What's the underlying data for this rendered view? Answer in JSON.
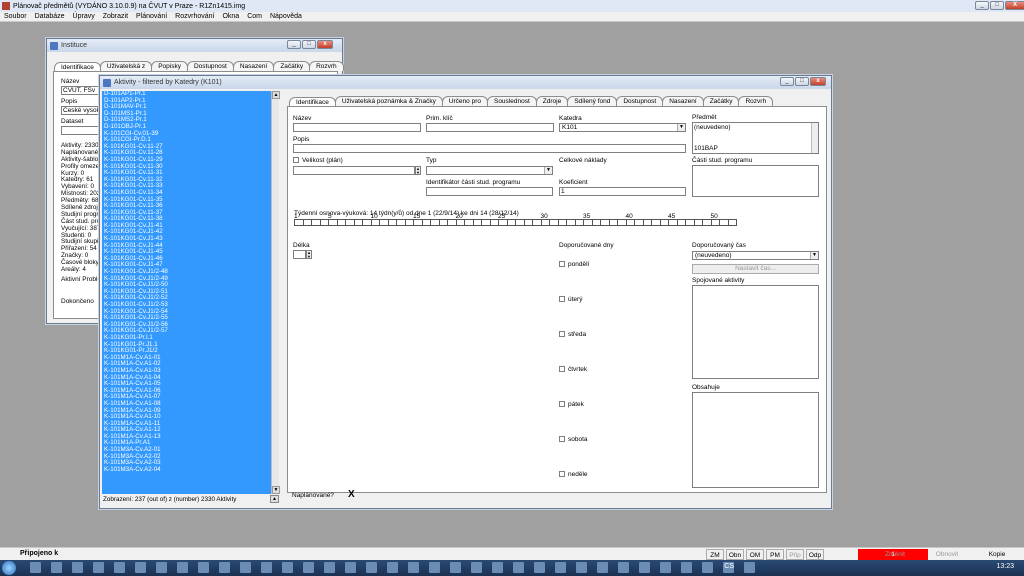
{
  "app": {
    "title": "Plánovač předmětů (VYDÁNO 3.10.0.9) na ČVUT v Praze - R1Zn1415.img",
    "min": "_",
    "max": "□",
    "close": "X"
  },
  "menu": [
    "Soubor",
    "Databáze",
    "Úpravy",
    "Zobrazit",
    "Plánování",
    "Rozvrhování",
    "Okna",
    "Com",
    "Nápověda"
  ],
  "instituce": {
    "title": "Instituce",
    "tabs": [
      "Identifikace",
      "Uživatelská z",
      "Popisky",
      "Dostupnost",
      "Nasazení",
      "Začátky",
      "Rozvrh"
    ],
    "nazev_label": "Název",
    "nazev_value": "ČVUT, FSv",
    "popis_label": "Popis",
    "popis_value": "České vysoké",
    "dataset_label": "Dataset",
    "stats": [
      "Aktivity: 2330 (",
      "Naplánované",
      "Aktivity-šablony",
      "Profily omezení",
      "Kurzy: 0",
      "Katedry: 61",
      "Vybavení: 0",
      "Místnosti: 202",
      "Předměty: 686",
      "Sdílené zdroje:",
      "Studijní program",
      "Část stud. prog",
      "Vyučující: 387",
      "Studenti: 0",
      "Studijní skupiny",
      "Přiřazení: 54",
      "Značky: 0",
      "Časové bloky:",
      "Areály: 4"
    ],
    "aktivni": "Aktivní Problém",
    "dokonceno": "Dokončeno"
  },
  "aktivity": {
    "title": "Aktivity - filtered by Katedry (K101)",
    "list": [
      "D-101AP1-Pr.1",
      "D-101AP2-Pr.1",
      "D-101MAV-Pr.1",
      "D-101MS1-Pr.1",
      "D-101MS2-Pr.1",
      "D-101OBJ-Pr.1",
      "K-101CGI-Cv.01-39",
      "K-101CGI-Pr.D.1",
      "K-101KG01-Cv.11-27",
      "K-101KG01-Cv.11-28",
      "K-101KG01-Cv.11-29",
      "K-101KG01-Cv.11-30",
      "K-101KG01-Cv.11-31",
      "K-101KG01-Cv.11-32",
      "K-101KG01-Cv.11-33",
      "K-101KG01-Cv.11-34",
      "K-101KG01-Cv.11-35",
      "K-101KG01-Cv.11-36",
      "K-101KG01-Cv.11-37",
      "K-101KG01-Cv.11-38",
      "K-101KG01-Cv.J1-41",
      "K-101KG01-Cv.J1-42",
      "K-101KG01-Cv.J1-43",
      "K-101KG01-Cv.J1-44",
      "K-101KG01-Cv.J1-45",
      "K-101KG01-Cv.J1-46",
      "K-101KG01-Cv.J1-47",
      "K-101KG01-Cv.J1/2-48",
      "K-101KG01-Cv.J1/2-49",
      "K-101KG01-Cv.J1/2-50",
      "K-101KG01-Cv.J1/2-51",
      "K-101KG01-Cv.J1/2-52",
      "K-101KG01-Cv.J1/2-53",
      "K-101KG01-Cv.J1/2-54",
      "K-101KG01-Cv.J1/2-55",
      "K-101KG01-Cv.J1/2-56",
      "K-101KG01-Cv.J1/2-57",
      "K-101KG01-Pr.I.1",
      "K-101KG01-Pr.J1.1",
      "K-101KG01-Pr.J1/2",
      "K-101M1A-Cv.A1-01",
      "K-101M1A-Cv.A1-02",
      "K-101M1A-Cv.A1-03",
      "K-101M1A-Cv.A1-04",
      "K-101M1A-Cv.A1-05",
      "K-101M1A-Cv.A1-06",
      "K-101M1A-Cv.A1-07",
      "K-101M1A-Cv.A1-08",
      "K-101M1A-Cv.A1-09",
      "K-101M1A-Cv.A1-10",
      "K-101M1A-Cv.A1-11",
      "K-101M1A-Cv.A1-12",
      "K-101M1A-Cv.A1-13",
      "K-101M1A-Pr.A1",
      "K-101M3A-Cv.A2-01",
      "K-101M3A-Cv.A2-02",
      "K-101M3A-Cv.A2-03",
      "K-101M3A-Cv.A2-04"
    ],
    "footer": "Zobrazení: 237 (out of) z (number) 2330 Aktivity",
    "tabs": [
      "Identifikace",
      "Uživatelská poznámka & Značky",
      "Určeno pro",
      "Souslednost",
      "Zdroje",
      "Sdílený fond",
      "Dostupnost",
      "Nasazení",
      "Začátky",
      "Rozvrh"
    ],
    "nazev_label": "Název",
    "prim_klic_label": "Prim. klíč",
    "katedra_label": "Katedra",
    "katedra_value": "K101",
    "predmet_label": "Předmět",
    "predmet_value": "(neuvedeno)",
    "predmet_item2": "101BAP",
    "popis_label": "Popis",
    "velikost_label": "Velikost (plán)",
    "typ_label": "Typ",
    "celkove_label": "Celkové náklady",
    "cast_label": "Části stud. programu",
    "identifikator_label": "Identifikátor části stud. programu",
    "koeficient_label": "Koeficient",
    "koeficient_value": "1",
    "tydenni_label": "Týdenní osnova-výuková: 14 týdn(y/ů) od dne 1 (22/9/14) ke dni 14 (28/12/14)",
    "week_ticks": [
      "1",
      "5",
      "10",
      "15",
      "20",
      "25",
      "30",
      "35",
      "40",
      "45",
      "50"
    ],
    "delka_label": "Délka",
    "dny_label": "Doporučované dny",
    "days": [
      "pondělí",
      "úterý",
      "středa",
      "čtvrtek",
      "pátek",
      "sobota",
      "neděle"
    ],
    "cas_label": "Doporučovaný čas",
    "cas_value": "(neuvedeno)",
    "nastavit_label": "Nastavit čas...",
    "spojovane_label": "Spojované aktivity",
    "obsahuje_label": "Obsahuje",
    "naplanovane_label": "Naplánované?",
    "naplanovane_value": "X"
  },
  "status": {
    "text": "Připojeno k",
    "buttons": [
      "ZM",
      "Obn",
      "OM",
      "PM",
      "Přip",
      "Odp"
    ],
    "red_value": "1",
    "zmenit": "Změnit",
    "obnovit": "Obnovit",
    "kopie": "Kopie"
  },
  "taskbar": {
    "lang": "CS",
    "clock": "13:23"
  }
}
